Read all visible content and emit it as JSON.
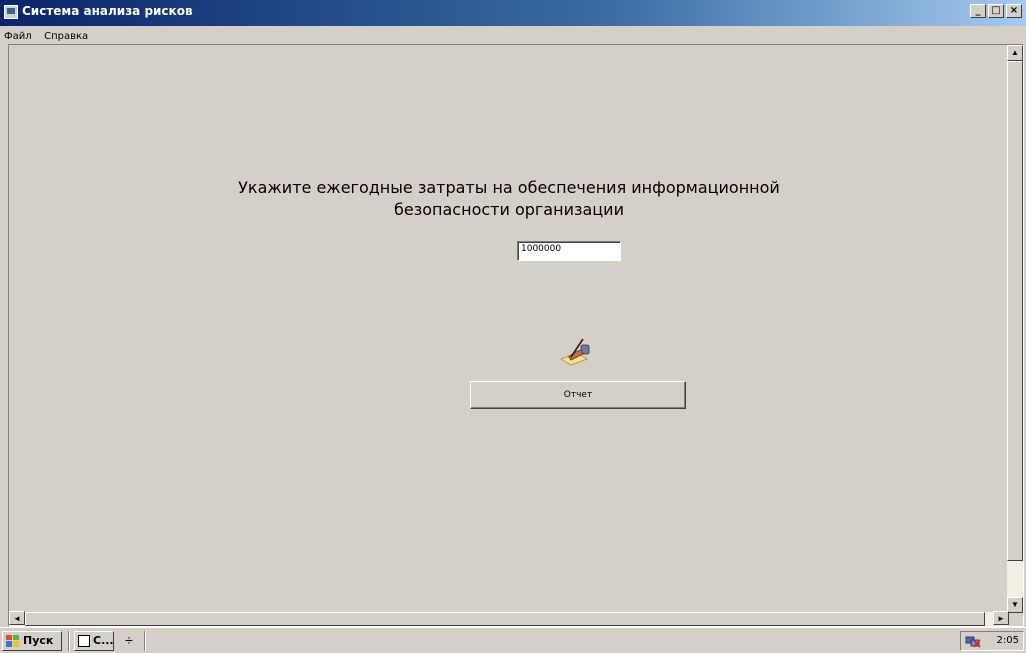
{
  "window": {
    "title": "Система анализа рисков",
    "controls": {
      "minimize": "_",
      "maximize": "□",
      "close": "×"
    }
  },
  "menubar": {
    "items": [
      {
        "label": "Файл"
      },
      {
        "label": "Справка"
      }
    ]
  },
  "main": {
    "prompt_line1": "Укажите ежегодные затраты на обеспечения информационной",
    "prompt_line2": "безопасности организации",
    "amount_value": "1000000",
    "report_button_label": "Отчет",
    "report_icon": "writing-hand-icon"
  },
  "taskbar": {
    "start_label": "Пуск",
    "task_button_label": "С...",
    "clock": "2:05",
    "tray_icon": "network-disconnected-icon"
  },
  "colors": {
    "window_bg": "#d4d0c8",
    "titlebar_start": "#0a246a",
    "titlebar_end": "#a6caf0"
  }
}
